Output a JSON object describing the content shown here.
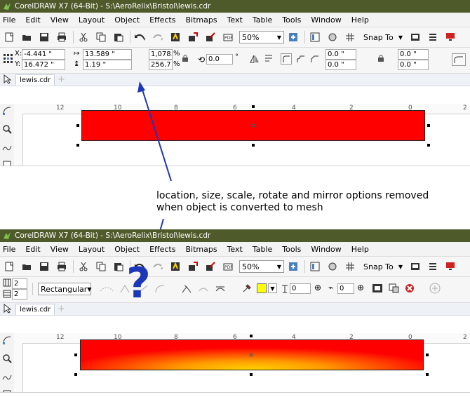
{
  "annotation": "location, size, scale, rotate and mirror options removed when object is converted to mesh",
  "question_mark": "?",
  "window_top": {
    "title": "CorelDRAW X7 (64-Bit) - S:\\AeroRelix\\Bristol\\lewis.cdr",
    "menu": [
      "File",
      "Edit",
      "View",
      "Layout",
      "Object",
      "Effects",
      "Bitmaps",
      "Text",
      "Table",
      "Tools",
      "Window",
      "Help"
    ],
    "zoom": "50%",
    "snap_to": "Snap To",
    "props": {
      "x": "-4.441 \"",
      "y": "16.472 \"",
      "width": "13.589 \"",
      "height": "1.19 \"",
      "scale_x": "1,078.1",
      "scale_y": "256.7",
      "pct": "%",
      "rotate": "0.0",
      "degree": "°",
      "pos_x": "0.0 \"",
      "pos_y": "0.0 \"",
      "corner_1": "0.0 \"",
      "corner_2": "0.0 \""
    },
    "doc_tab": "lewis.cdr",
    "ruler": [
      "12",
      "10",
      "8",
      "6",
      "4",
      "2",
      "0",
      "2"
    ]
  },
  "window_bottom": {
    "title": "CorelDRAW X7 (64-Bit) - S:\\AeroRelix\\Bristol\\lewis.cdr",
    "menu": [
      "File",
      "Edit",
      "View",
      "Layout",
      "Object",
      "Effects",
      "Bitmaps",
      "Text",
      "Table",
      "Tools",
      "Window",
      "Help"
    ],
    "zoom": "50%",
    "snap_to": "Snap To",
    "props": {
      "grid_cols": "2",
      "grid_rows": "2",
      "selection_mode": "Rectangular",
      "transparency": "0",
      "smoothing": "0"
    },
    "doc_tab": "lewis.cdr",
    "ruler": [
      "12",
      "10",
      "8",
      "6",
      "4",
      "2",
      "0",
      "2"
    ]
  },
  "colors": {
    "titlebar": "#4f5a2b",
    "rect_fill": "#ff0000",
    "mesh_bottom": "#ffd400",
    "arrow": "#1c37b8",
    "swatch": "#ffff00"
  }
}
